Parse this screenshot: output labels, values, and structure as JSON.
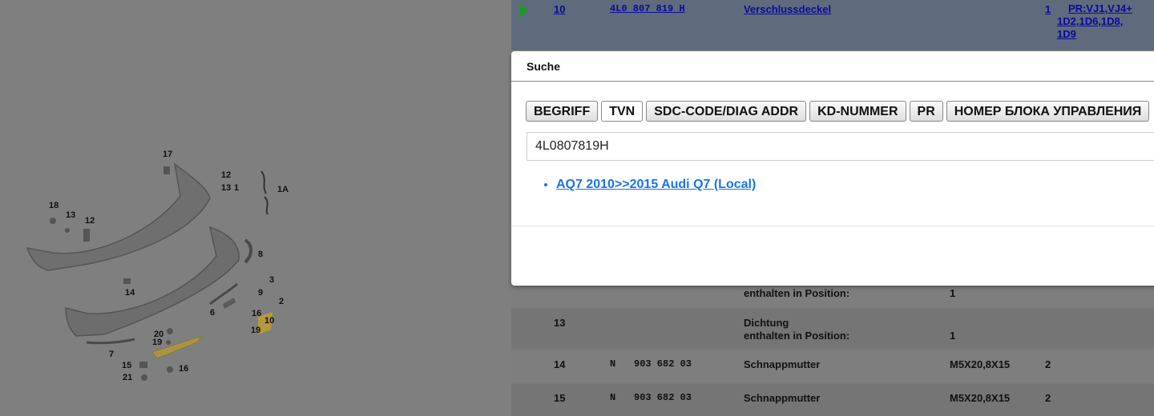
{
  "diagram": {
    "callouts": [
      "17",
      "12",
      "13",
      "1",
      "1A",
      "18",
      "13",
      "12",
      "8",
      "3",
      "2",
      "9",
      "6",
      "16",
      "10",
      "19",
      "14",
      "7",
      "20",
      "19",
      "15",
      "16",
      "21"
    ]
  },
  "table": {
    "rows": [
      {
        "pos": "10",
        "n": "",
        "partno": "4L0 807 819 H",
        "desc": "Verschlussdeckel",
        "desc2": "",
        "qty_left": "",
        "qty": "1",
        "code": "PR:VJ1,VJ4+ 1D2,1D6,1D8, 1D9",
        "code_lines": [
          "PR:VJ1,VJ4+",
          "1D2,1D6,1D8,",
          "1D9"
        ]
      },
      {
        "pos": "",
        "n": "",
        "partno": "",
        "desc": "",
        "desc2": "enthalten in Position:",
        "qty_left": "1",
        "qty": "",
        "code": ""
      },
      {
        "pos": "13",
        "n": "",
        "partno": "",
        "desc": "Dichtung",
        "desc2": "enthalten in Position:",
        "qty_left": "1",
        "qty": "",
        "code": ""
      },
      {
        "pos": "14",
        "n": "N",
        "partno": "903 682 03",
        "desc": "Schnappmutter",
        "desc2": "",
        "qty_left": "M5X20,8X15",
        "qty": "2",
        "code": ""
      },
      {
        "pos": "15",
        "n": "N",
        "partno": "903 682 03",
        "desc": "Schnappmutter",
        "desc2": "",
        "qty_left": "M5X20,8X15",
        "qty": "2",
        "code": ""
      }
    ]
  },
  "dialog": {
    "title": "Suche",
    "tabs": [
      "BEGRIFF",
      "TVN",
      "SDC-CODE/DIAG ADDR",
      "KD-NUMMER",
      "PR",
      "НОМЕР БЛОКА УПРАВЛЕНИЯ"
    ],
    "active_tab": "TVN",
    "search_value": "4L0807819H",
    "results": [
      "AQ7 2010>>2015 Audi Q7 (Local)"
    ]
  },
  "colors": {
    "overlay": "#808080",
    "selected_row": "#5f6b7d",
    "link": "#1a73e8",
    "play_icon": "#1e9b1e",
    "highlight_part": "#b59a3c"
  }
}
